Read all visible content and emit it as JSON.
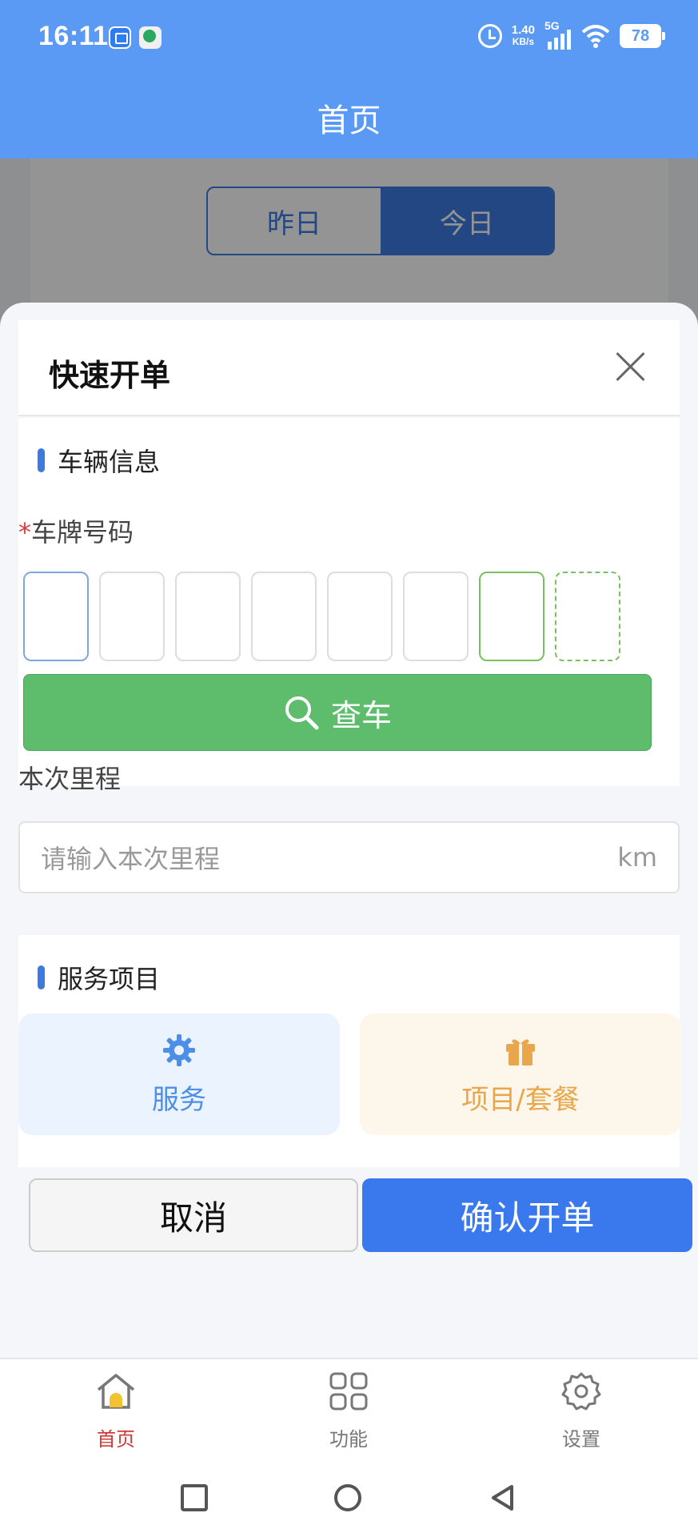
{
  "status_bar": {
    "time": "16:11",
    "net_speed_value": "1.40",
    "net_speed_unit": "KB/s",
    "network": "5G",
    "battery": "78",
    "icons": [
      "alarm-icon",
      "signal-icon",
      "wifi-icon",
      "battery-icon"
    ]
  },
  "header": {
    "title": "首页"
  },
  "background_page": {
    "toggle": {
      "yesterday": "昨日",
      "today": "今日",
      "selected": "今日"
    }
  },
  "sheet": {
    "title": "快速开单",
    "vehicle_section": {
      "title": "车辆信息",
      "plate_label": "车牌号码",
      "required_mark": "*",
      "plate_slots": 8,
      "query_button": "查车"
    },
    "mileage": {
      "label": "本次里程",
      "placeholder": "请输入本次里程",
      "unit": "km"
    },
    "service_section": {
      "title": "服务项目",
      "service_label": "服务",
      "package_label": "项目/套餐"
    },
    "cancel_button": "取消",
    "confirm_button": "确认开单"
  },
  "tabbar": {
    "items": [
      {
        "label": "首页",
        "icon": "home-icon",
        "active": true
      },
      {
        "label": "功能",
        "icon": "grid-icon",
        "active": false
      },
      {
        "label": "设置",
        "icon": "gear-icon",
        "active": false
      }
    ]
  },
  "colors": {
    "header": "#5a9af5",
    "accent": "#3a78ee",
    "query_green": "#5dbd6d",
    "active_tab": "#d23a3a",
    "service": "#4d8fe6",
    "package": "#e9a64a"
  }
}
